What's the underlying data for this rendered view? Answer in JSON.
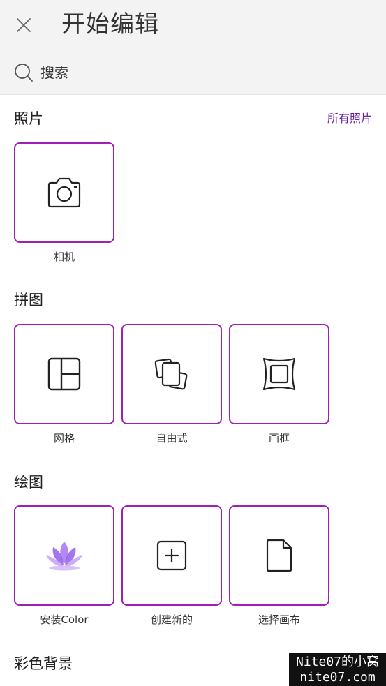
{
  "header": {
    "title": "开始编辑",
    "close_icon": "close-icon",
    "search_placeholder": "搜索",
    "search_icon": "search-icon"
  },
  "sections": {
    "photos": {
      "title": "照片",
      "link": "所有照片",
      "items": [
        {
          "label": "相机",
          "icon": "camera-icon"
        }
      ]
    },
    "collage": {
      "title": "拼图",
      "items": [
        {
          "label": "网格",
          "icon": "grid-layout-icon"
        },
        {
          "label": "自由式",
          "icon": "freestyle-icon"
        },
        {
          "label": "画框",
          "icon": "frame-icon"
        }
      ]
    },
    "drawing": {
      "title": "绘图",
      "items": [
        {
          "label": "安装Color",
          "icon": "lotus-icon"
        },
        {
          "label": "创建新的",
          "icon": "add-square-icon"
        },
        {
          "label": "选择画布",
          "icon": "canvas-page-icon"
        }
      ]
    },
    "backgrounds": {
      "title": "彩色背景"
    }
  },
  "colors": {
    "accent": "#a01fb5",
    "link": "#6b1fb0",
    "lotus": "#9b5ae6"
  },
  "watermark": {
    "line1": "Nite07的小窝",
    "line2": "nite07.com"
  }
}
